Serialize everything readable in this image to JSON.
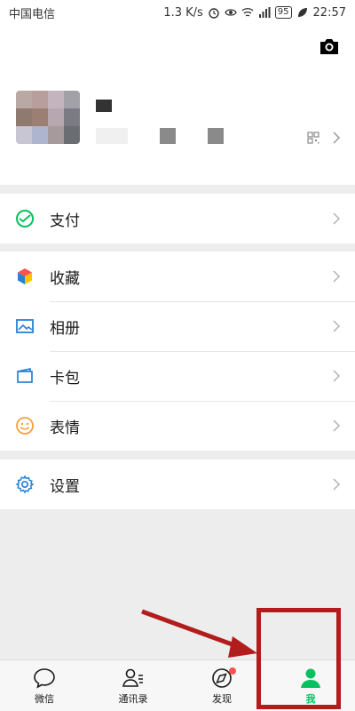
{
  "status_bar": {
    "carrier": "中国电信",
    "speed": "1.3 K/s",
    "battery": "95",
    "time": "22:57"
  },
  "profile": {
    "avatar_colors": [
      "#b9a8a3",
      "#b89e9c",
      "#c4b4bd",
      "#a3a1a8",
      "#8f7a70",
      "#9b7f72",
      "#b7a7b0",
      "#7b7b84",
      "#c9c6d3",
      "#aeb6cf",
      "#a79a9c",
      "#6a6d72"
    ]
  },
  "menu": {
    "pay": "支付",
    "favorites": "收藏",
    "album": "相册",
    "cards": "卡包",
    "stickers": "表情",
    "settings": "设置"
  },
  "tabs": {
    "chats": "微信",
    "contacts": "通讯录",
    "discover": "发现",
    "me": "我"
  },
  "colors": {
    "accent": "#07c160",
    "highlight": "#b21c1c",
    "badge": "#fa5151"
  }
}
